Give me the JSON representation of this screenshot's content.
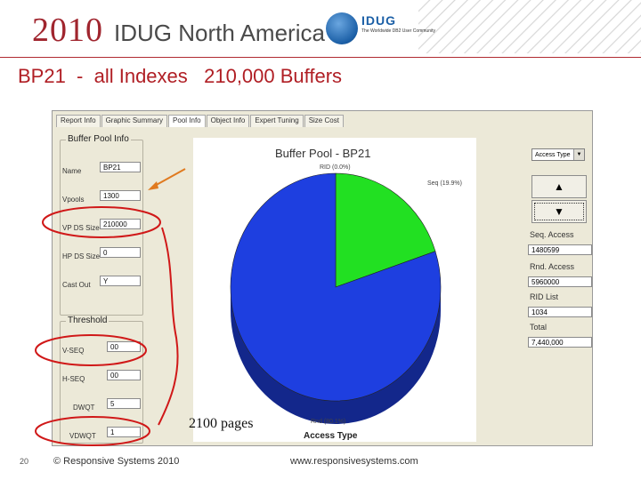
{
  "header": {
    "year": "2010",
    "event": "IDUG North America",
    "logo_text": "IDUG",
    "logo_tagline": "The Worldwide DB2 User Community"
  },
  "slide": {
    "title": "BP21  -  all Indexes   210,000 Buffers"
  },
  "app": {
    "tabs": [
      {
        "label": "Report Info"
      },
      {
        "label": "Graphic Summary"
      },
      {
        "label": "Pool Info",
        "active": true
      },
      {
        "label": "Object Info"
      },
      {
        "label": "Expert Tuning"
      },
      {
        "label": "Size Cost"
      }
    ],
    "buffer_pool_info": {
      "label": "Buffer Pool Info",
      "fields": [
        {
          "label": "Name",
          "value": "BP21"
        },
        {
          "label": "Vpools",
          "value": "1300"
        },
        {
          "label": "VP DS Size",
          "value": "210000"
        },
        {
          "label": "HP DS Size",
          "value": "0"
        },
        {
          "label": "Cast Out",
          "value": "Y"
        }
      ]
    },
    "threshold": {
      "label": "Threshold",
      "fields": [
        {
          "label": "V-SEQ",
          "value": "00"
        },
        {
          "label": "H-SEQ",
          "value": "00"
        },
        {
          "label": "DWQT",
          "value": "5"
        },
        {
          "label": "VDWQT",
          "value": "1"
        }
      ]
    },
    "chart_data": {
      "type": "pie",
      "title": "Buffer Pool - BP21",
      "xlabel": "Access Type",
      "slices": [
        {
          "label": "RID (0.0%)",
          "value": 0.0,
          "color": "#d9d9d9"
        },
        {
          "label": "Seq (19.9%)",
          "value": 19.9,
          "color": "#22e022"
        },
        {
          "label": "Rnd (80.1%)",
          "value": 80.1,
          "color": "#1e3fe0"
        }
      ]
    },
    "right_panel": {
      "dropdown_value": "Access Type",
      "up_icon": "arrow-up-icon",
      "down_icon": "arrow-down-icon",
      "stats": [
        {
          "label": "Seq. Access",
          "value": "1480599"
        },
        {
          "label": "Rnd. Access",
          "value": "5960000"
        },
        {
          "label": "RID List",
          "value": "1034"
        },
        {
          "label": "Total",
          "value": "7,440,000"
        }
      ]
    }
  },
  "annotation": {
    "text": "2100 pages",
    "arrow_color": "#e07a1f",
    "circle_color": "#d01818"
  },
  "footer": {
    "page": "20",
    "copyright": "© Responsive Systems 2010",
    "url": "www.responsivesystems.com"
  }
}
